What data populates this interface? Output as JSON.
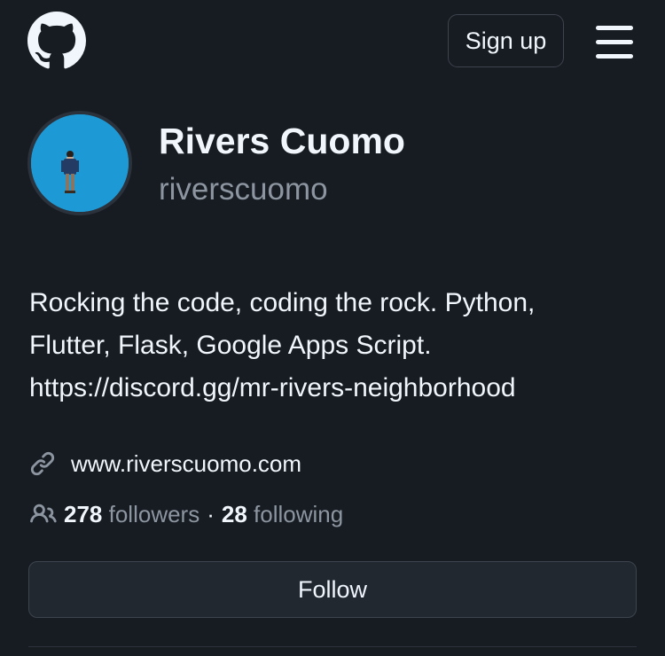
{
  "header": {
    "logo_icon": "github-logo-icon",
    "signup_label": "Sign up",
    "menu_icon": "hamburger-menu-icon"
  },
  "profile": {
    "avatar_icon": "avatar-photo",
    "full_name": "Rivers Cuomo",
    "username": "riverscuomo",
    "bio_lines": [
      "Rocking the code, coding the rock. Python,",
      "Flutter, Flask, Google Apps Script.",
      "https://discord.gg/mr-rivers-neighborhood"
    ],
    "website_icon": "link-icon",
    "website": "www.riverscuomo.com",
    "people_icon": "people-icon",
    "followers_count": "278",
    "followers_label": "followers",
    "separator": "·",
    "following_count": "28",
    "following_label": "following",
    "follow_label": "Follow"
  },
  "colors": {
    "background": "#171b22",
    "text": "#f0f6fc",
    "muted": "#8d96a0",
    "border": "#3d444d",
    "avatar_bg": "#1d9ad6"
  }
}
